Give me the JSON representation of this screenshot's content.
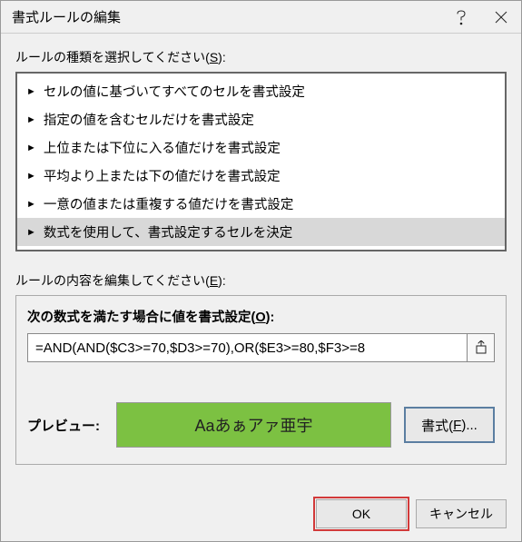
{
  "titlebar": {
    "title": "書式ルールの編集"
  },
  "sections": {
    "ruleTypeLabel": "ルールの種類を選択してください(",
    "ruleTypeAccel": "S",
    "ruleTypeLabelEnd": "):",
    "ruleItems": [
      "セルの値に基づいてすべてのセルを書式設定",
      "指定の値を含むセルだけを書式設定",
      "上位または下位に入る値だけを書式設定",
      "平均より上または下の値だけを書式設定",
      "一意の値または重複する値だけを書式設定",
      "数式を使用して、書式設定するセルを決定"
    ],
    "editLabel": "ルールの内容を編集してください(",
    "editAccel": "E",
    "editLabelEnd": "):",
    "formulaLabel": "次の数式を満たす場合に値を書式設定(",
    "formulaAccel": "O",
    "formulaLabelEnd": "):",
    "formula": "=AND(AND($C3>=70,$D3>=70),OR($E3>=80,$F3>=8",
    "previewLabel": "プレビュー:",
    "previewText": "Aaあぁアァ亜宇",
    "formatBtn": "書式(",
    "formatAccel": "F",
    "formatBtnEnd": ")..."
  },
  "footer": {
    "ok": "OK",
    "cancel": "キャンセル"
  },
  "colors": {
    "preview_bg": "#7cc142"
  }
}
